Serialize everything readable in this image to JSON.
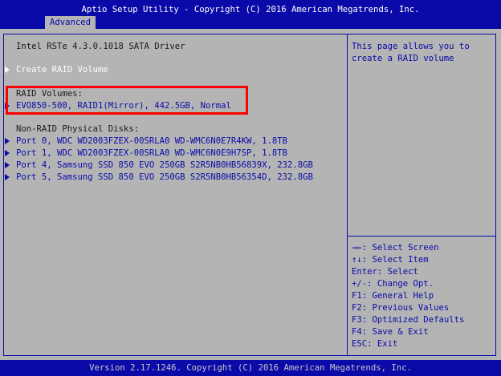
{
  "header": {
    "title": "Aptio Setup Utility - Copyright (C) 2016 American Megatrends, Inc.",
    "active_tab": "Advanced"
  },
  "main": {
    "driver_title": "Intel RSTe 4.3.0.1018 SATA Driver",
    "create_raid": "Create RAID Volume",
    "raid_volumes_heading": "RAID Volumes:",
    "raid_volumes": [
      "EVO850-500, RAID1(Mirror), 442.5GB, Normal"
    ],
    "non_raid_heading": "Non-RAID Physical Disks:",
    "disks": [
      "Port 0, WDC WD2003FZEX-00SRLA0 WD-WMC6N0E7R4KW, 1.8TB",
      "Port 1, WDC WD2003FZEX-00SRLA0 WD-WMC6N0E9H7SP, 1.8TB",
      "Port 4, Samsung SSD 850 EVO 250GB S2R5NB0HB56839X, 232.8GB",
      "Port 5, Samsung SSD 850 EVO 250GB S2R5NB0HB56354D, 232.8GB"
    ]
  },
  "help": {
    "lines": [
      "This page allows you to",
      "create a RAID volume"
    ]
  },
  "keys": [
    {
      "key": "→←:",
      "action": "Select Screen"
    },
    {
      "key": "↑↓:",
      "action": "Select Item"
    },
    {
      "key": "Enter:",
      "action": "Select"
    },
    {
      "key": "+/-:",
      "action": "Change Opt."
    },
    {
      "key": "F1:",
      "action": "General Help"
    },
    {
      "key": "F2:",
      "action": "Previous Values"
    },
    {
      "key": "F3:",
      "action": "Optimized Defaults"
    },
    {
      "key": "F4:",
      "action": "Save & Exit"
    },
    {
      "key": "ESC:",
      "action": "Exit"
    }
  ],
  "footer": {
    "version": "Version 2.17.1246. Copyright (C) 2016 American Megatrends, Inc."
  },
  "colors": {
    "bios_blue": "#0a0aa8",
    "bios_gray": "#b4b4b4",
    "annotation_red": "#ff0000"
  }
}
